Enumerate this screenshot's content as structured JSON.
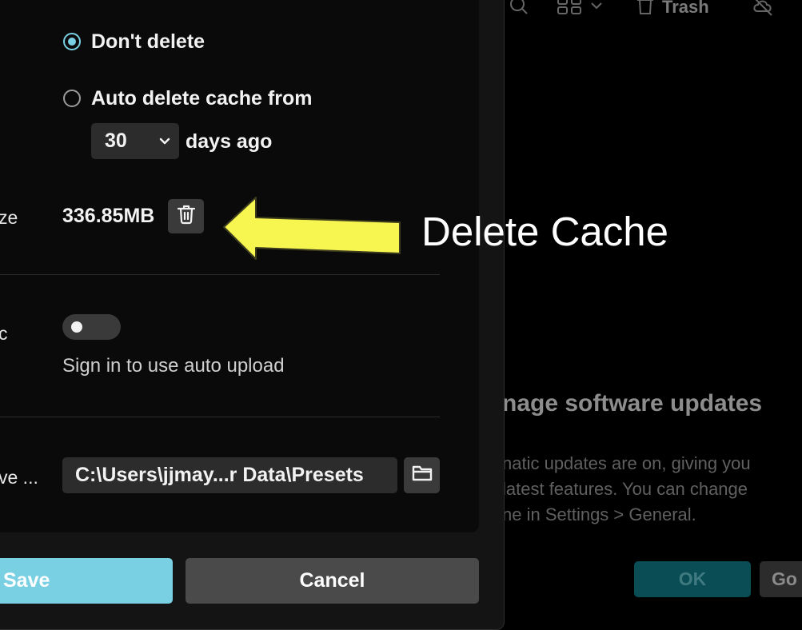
{
  "background": {
    "toolbar": {
      "trash_label": "Trash",
      "icons": [
        "search-icon",
        "grid-view-icon",
        "chevron-down-icon",
        "trash-icon",
        "cloud-off-icon"
      ]
    },
    "notice": {
      "heading": "nage software updates",
      "body_lines": [
        "natic updates are on, giving you",
        "latest features. You can change",
        "ne in Settings > General."
      ],
      "ok_label": "OK",
      "go_label": "Go"
    }
  },
  "dialog": {
    "cache": {
      "options": [
        {
          "label": "Don't delete",
          "selected": true
        },
        {
          "label": "Auto delete cache from",
          "selected": false
        }
      ],
      "days_select": {
        "value": "30",
        "suffix": "days ago"
      },
      "size_row_label": "ze",
      "size_value": "336.85MB"
    },
    "sync": {
      "row_label": "c",
      "toggle_on": false,
      "hint": "Sign in to use auto upload"
    },
    "save_location": {
      "row_label": "ve ...",
      "path": "C:\\Users\\jjmay...r Data\\Presets"
    },
    "buttons": {
      "save_label": "Save",
      "cancel_label": "Cancel"
    },
    "colors": {
      "accent": "#7ad0e3",
      "panel": "#0a0a0a",
      "field": "#2c2c2c",
      "arrow": "#f7f54f"
    }
  },
  "annotation": {
    "text": "Delete Cache",
    "arrow_icon": "yellow-arrow-left-icon"
  }
}
